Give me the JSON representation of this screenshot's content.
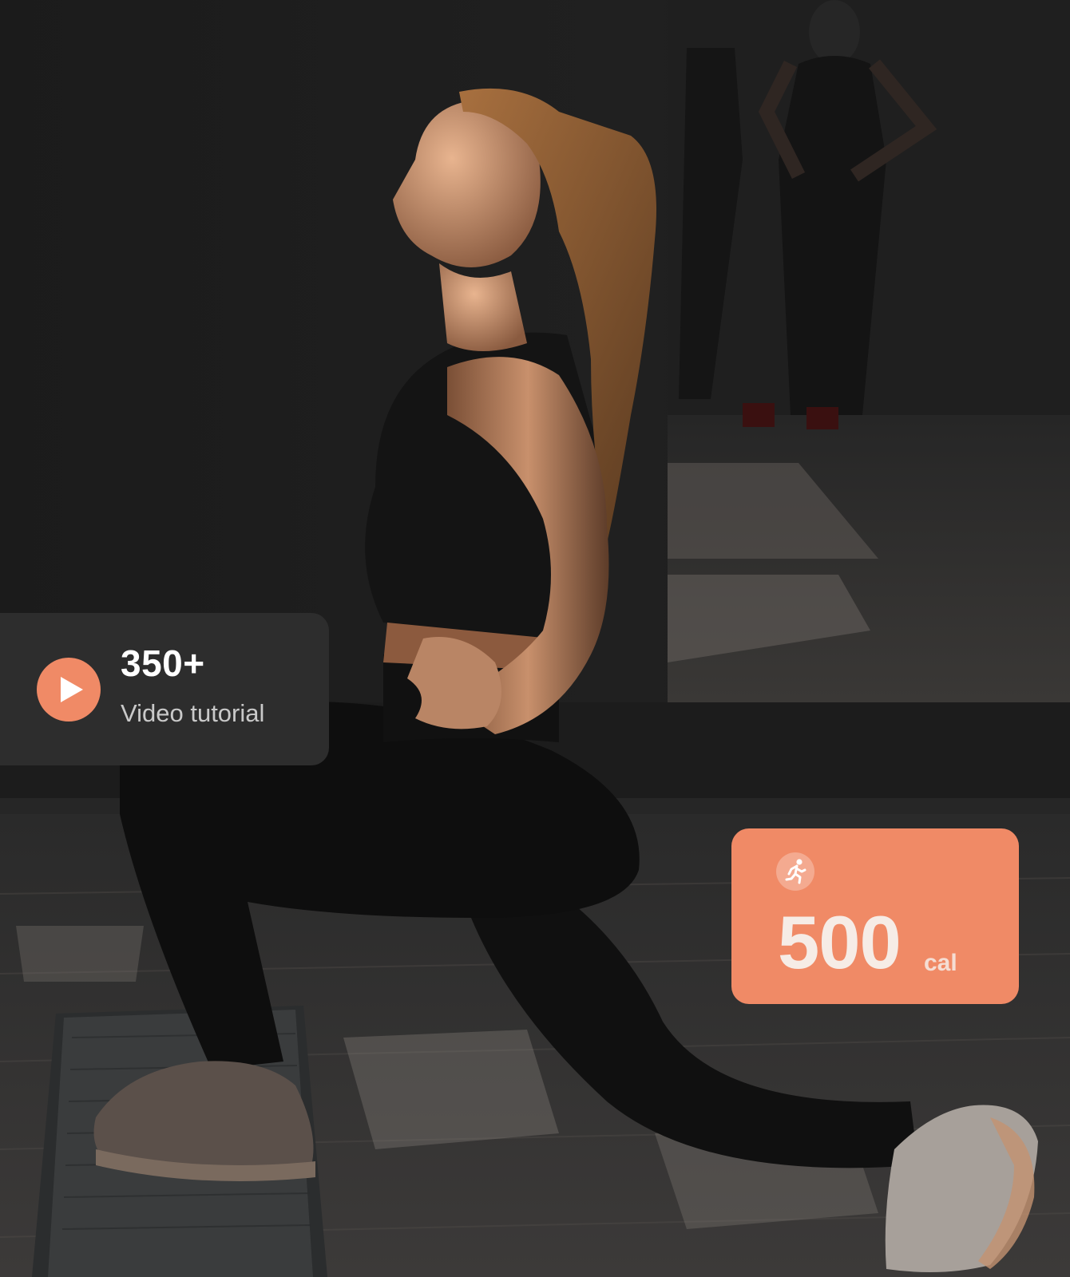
{
  "stats_card": {
    "value": "350+",
    "label": "Video tutorial",
    "icon": "play-icon"
  },
  "calorie_card": {
    "value": "500",
    "unit": "cal",
    "icon": "running-person-icon"
  },
  "colors": {
    "accent": "#f08a66",
    "card_dark": "#2d2d2d",
    "background": "#141414"
  }
}
